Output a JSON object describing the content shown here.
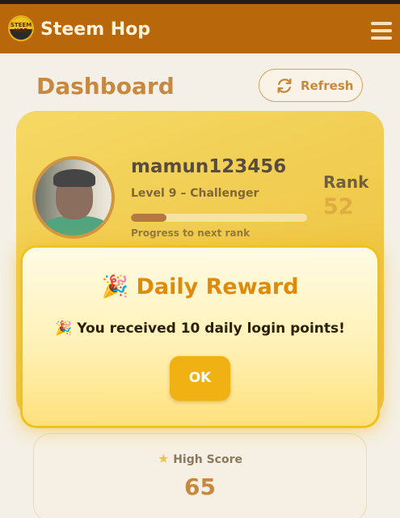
{
  "header": {
    "logo_text": "STEEM HOP",
    "app_title": "Steem Hop"
  },
  "dashboard": {
    "title": "Dashboard",
    "refresh_label": "Refresh"
  },
  "profile": {
    "username": "mamun123456",
    "level": "Level 9 – Challenger",
    "progress_label": "Progress to next rank",
    "progress_fraction": 0.2,
    "rank_label": "Rank",
    "rank_value": "52"
  },
  "stats": {
    "high_score_label": "High Score",
    "high_score_value": "65"
  },
  "modal": {
    "title_emoji": "🎉",
    "title": "Daily Reward",
    "message_emoji": "🎉",
    "message": "You received 10 daily login points!",
    "ok_label": "OK"
  },
  "colors": {
    "accent": "#b8680a",
    "gold": "#f0b212"
  }
}
